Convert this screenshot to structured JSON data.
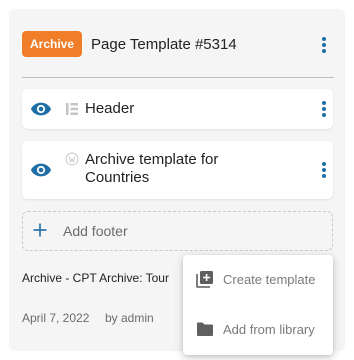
{
  "template": {
    "badge": "Archive",
    "title": "Page Template #5314"
  },
  "rows": [
    {
      "label": "Header"
    },
    {
      "label_line1": "Archive template for",
      "label_line2": "Countries"
    }
  ],
  "add_footer": {
    "label": "Add footer"
  },
  "meta": {
    "title": "Archive - CPT Archive: Tour",
    "date": "April 7, 2022",
    "author": "by admin"
  },
  "menu": {
    "items": [
      {
        "label": "Create template",
        "icon": "add-box-icon"
      },
      {
        "label": "Add from library",
        "icon": "folder-icon"
      }
    ]
  },
  "colors": {
    "accent": "#1e6fa5",
    "badge": "#f07e28"
  }
}
